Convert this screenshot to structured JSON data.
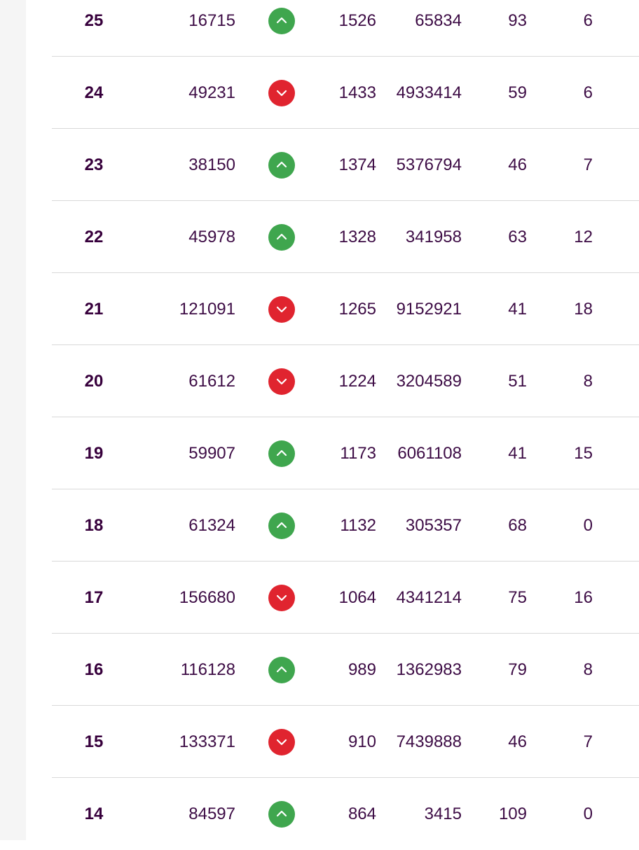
{
  "colors": {
    "up": "#3fa64e",
    "down": "#e0242f",
    "text": "#3d0c45"
  },
  "rows": [
    {
      "rank": "25",
      "col_a": "16715",
      "direction": "up",
      "col_b": "1526",
      "col_c": "65834",
      "col_d": "93",
      "col_e": "6"
    },
    {
      "rank": "24",
      "col_a": "49231",
      "direction": "down",
      "col_b": "1433",
      "col_c": "4933414",
      "col_d": "59",
      "col_e": "6"
    },
    {
      "rank": "23",
      "col_a": "38150",
      "direction": "up",
      "col_b": "1374",
      "col_c": "5376794",
      "col_d": "46",
      "col_e": "7"
    },
    {
      "rank": "22",
      "col_a": "45978",
      "direction": "up",
      "col_b": "1328",
      "col_c": "341958",
      "col_d": "63",
      "col_e": "12"
    },
    {
      "rank": "21",
      "col_a": "121091",
      "direction": "down",
      "col_b": "1265",
      "col_c": "9152921",
      "col_d": "41",
      "col_e": "18"
    },
    {
      "rank": "20",
      "col_a": "61612",
      "direction": "down",
      "col_b": "1224",
      "col_c": "3204589",
      "col_d": "51",
      "col_e": "8"
    },
    {
      "rank": "19",
      "col_a": "59907",
      "direction": "up",
      "col_b": "1173",
      "col_c": "6061108",
      "col_d": "41",
      "col_e": "15"
    },
    {
      "rank": "18",
      "col_a": "61324",
      "direction": "up",
      "col_b": "1132",
      "col_c": "305357",
      "col_d": "68",
      "col_e": "0"
    },
    {
      "rank": "17",
      "col_a": "156680",
      "direction": "down",
      "col_b": "1064",
      "col_c": "4341214",
      "col_d": "75",
      "col_e": "16"
    },
    {
      "rank": "16",
      "col_a": "116128",
      "direction": "up",
      "col_b": "989",
      "col_c": "1362983",
      "col_d": "79",
      "col_e": "8"
    },
    {
      "rank": "15",
      "col_a": "133371",
      "direction": "down",
      "col_b": "910",
      "col_c": "7439888",
      "col_d": "46",
      "col_e": "7"
    },
    {
      "rank": "14",
      "col_a": "84597",
      "direction": "up",
      "col_b": "864",
      "col_c": "3415",
      "col_d": "109",
      "col_e": "0"
    }
  ]
}
